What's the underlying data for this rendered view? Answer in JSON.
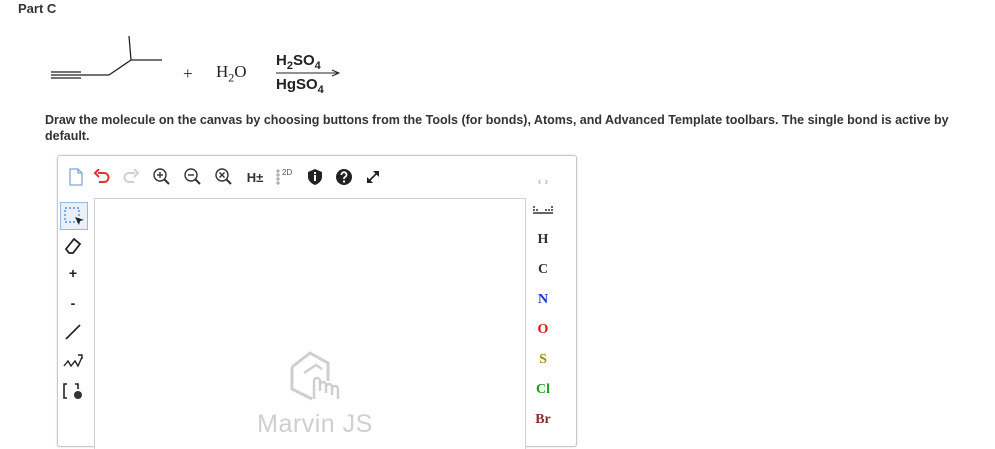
{
  "part_title": "Part C",
  "reaction": {
    "plus": "+",
    "water": {
      "symbol": "H",
      "sub": "2",
      "tail": "O"
    },
    "reagent_top": {
      "a": "H",
      "a_sub": "2",
      "b": "SO",
      "b_sub": "4"
    },
    "reagent_bottom": {
      "a": "HgSO",
      "a_sub": "4"
    }
  },
  "instructions": "Draw the molecule on the canvas by choosing buttons from the Tools (for bonds), Atoms, and Advanced Template toolbars. The single bond is active by default.",
  "toolbar": {
    "hydrogen_label": "H±",
    "twod_label": "2D",
    "icons": [
      "document-icon",
      "undo-icon",
      "redo-icon",
      "zoom-in-icon",
      "zoom-out-icon",
      "zoom-reset-icon",
      "hydrogen-toggle-icon",
      "clean-2d-icon",
      "info-icon",
      "help-icon",
      "fullscreen-icon"
    ]
  },
  "left_tools": {
    "plus_label": "+",
    "minus_label": "-",
    "icons": [
      "selection-icon",
      "eraser-icon",
      "increase-charge-icon",
      "decrease-charge-icon",
      "single-bond-icon",
      "chain-icon",
      "bracket-icon"
    ]
  },
  "atoms": [
    {
      "symbol": "H",
      "color": "#333333"
    },
    {
      "symbol": "C",
      "color": "#333333"
    },
    {
      "symbol": "N",
      "color": "#1a35c8"
    },
    {
      "symbol": "O",
      "color": "#e01010"
    },
    {
      "symbol": "S",
      "color": "#a08a10"
    },
    {
      "symbol": "Cl",
      "color": "#1aa01a"
    },
    {
      "symbol": "Br",
      "color": "#8a2a2a"
    }
  ],
  "watermark": "Marvin JS"
}
